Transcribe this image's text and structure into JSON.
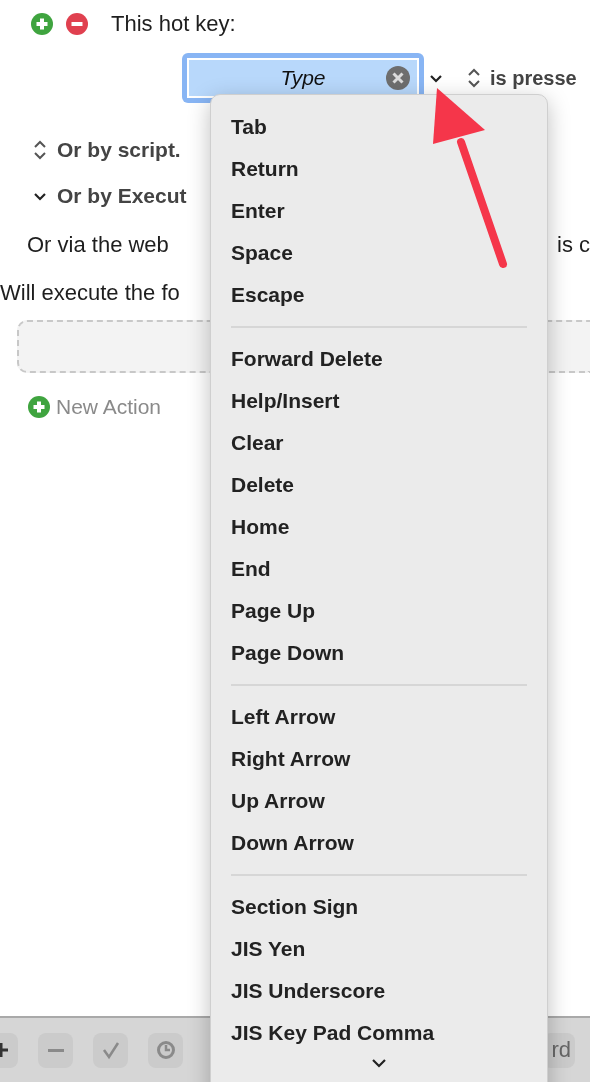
{
  "hotkey": {
    "title": "This hot key:",
    "key_field": {
      "value": "Type"
    },
    "trigger": "is presse"
  },
  "conditions": [
    {
      "kind": "popup",
      "label": "Or by script."
    },
    {
      "kind": "disclosure",
      "label": "Or by Execut",
      "expanded": true
    }
  ],
  "web_line": {
    "text": "Or via the web",
    "tail": "is c"
  },
  "execute_line": "Will execute the fo",
  "new_action": "New Action",
  "key_menu": {
    "groups": [
      [
        "Tab",
        "Return",
        "Enter",
        "Space",
        "Escape"
      ],
      [
        "Forward Delete",
        "Help/Insert",
        "Clear",
        "Delete",
        "Home",
        "End",
        "Page Up",
        "Page Down"
      ],
      [
        "Left Arrow",
        "Right Arrow",
        "Up Arrow",
        "Down Arrow"
      ],
      [
        "Section Sign",
        "JIS Yen",
        "JIS Underscore",
        "JIS Key Pad Comma"
      ]
    ]
  },
  "toolbar": {
    "buttons": [
      {
        "kind": "add"
      },
      {
        "kind": "remove"
      },
      {
        "kind": "check"
      },
      {
        "kind": "clock"
      }
    ],
    "right_button": "rd"
  }
}
